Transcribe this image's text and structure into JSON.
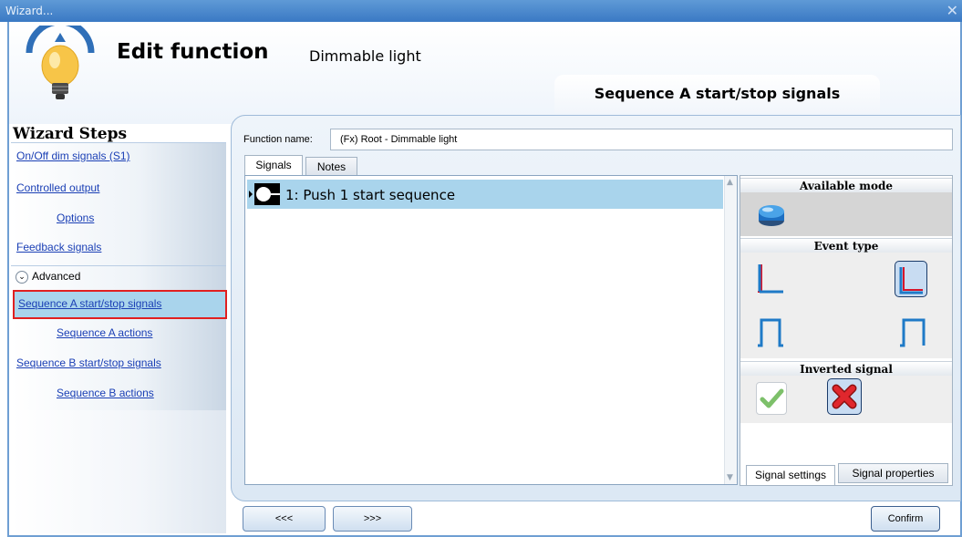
{
  "window": {
    "title": "Wizard...",
    "close_glyph": "✕"
  },
  "header": {
    "title": "Edit function",
    "subtitle": "Dimmable light",
    "step_tab": "Sequence A start/stop signals"
  },
  "sidebar": {
    "heading": "Wizard Steps",
    "items": [
      {
        "label": "On/Off dim signals (S1)"
      },
      {
        "label": "Controlled output"
      },
      {
        "label": "Options"
      },
      {
        "label": "Feedback signals"
      },
      {
        "label": "Sequence A start/stop signals"
      },
      {
        "label": "Sequence A actions"
      },
      {
        "label": "Sequence B start/stop signals"
      },
      {
        "label": "Sequence B actions"
      }
    ],
    "advanced_label": "Advanced"
  },
  "main": {
    "function_name_label": "Function name:",
    "function_name_value": "(Fx) Root - Dimmable light",
    "tabs": [
      {
        "label": "Signals"
      },
      {
        "label": "Notes"
      }
    ],
    "signals": [
      {
        "label": "1: Push 1 start sequence"
      }
    ]
  },
  "right_panel": {
    "available_mode": "Available mode",
    "event_type": "Event type",
    "inverted_signal": "Inverted signal",
    "tabs": [
      {
        "label": "Signal settings"
      },
      {
        "label": "Signal properties"
      }
    ]
  },
  "footer": {
    "back_label": "<<<",
    "next_label": ">>>",
    "confirm_label": "Confirm"
  },
  "colors": {
    "title_bar": "#3a79c4",
    "selection": "#a9d4ec",
    "link": "#1a3fb5",
    "highlight_border": "#e02020"
  }
}
